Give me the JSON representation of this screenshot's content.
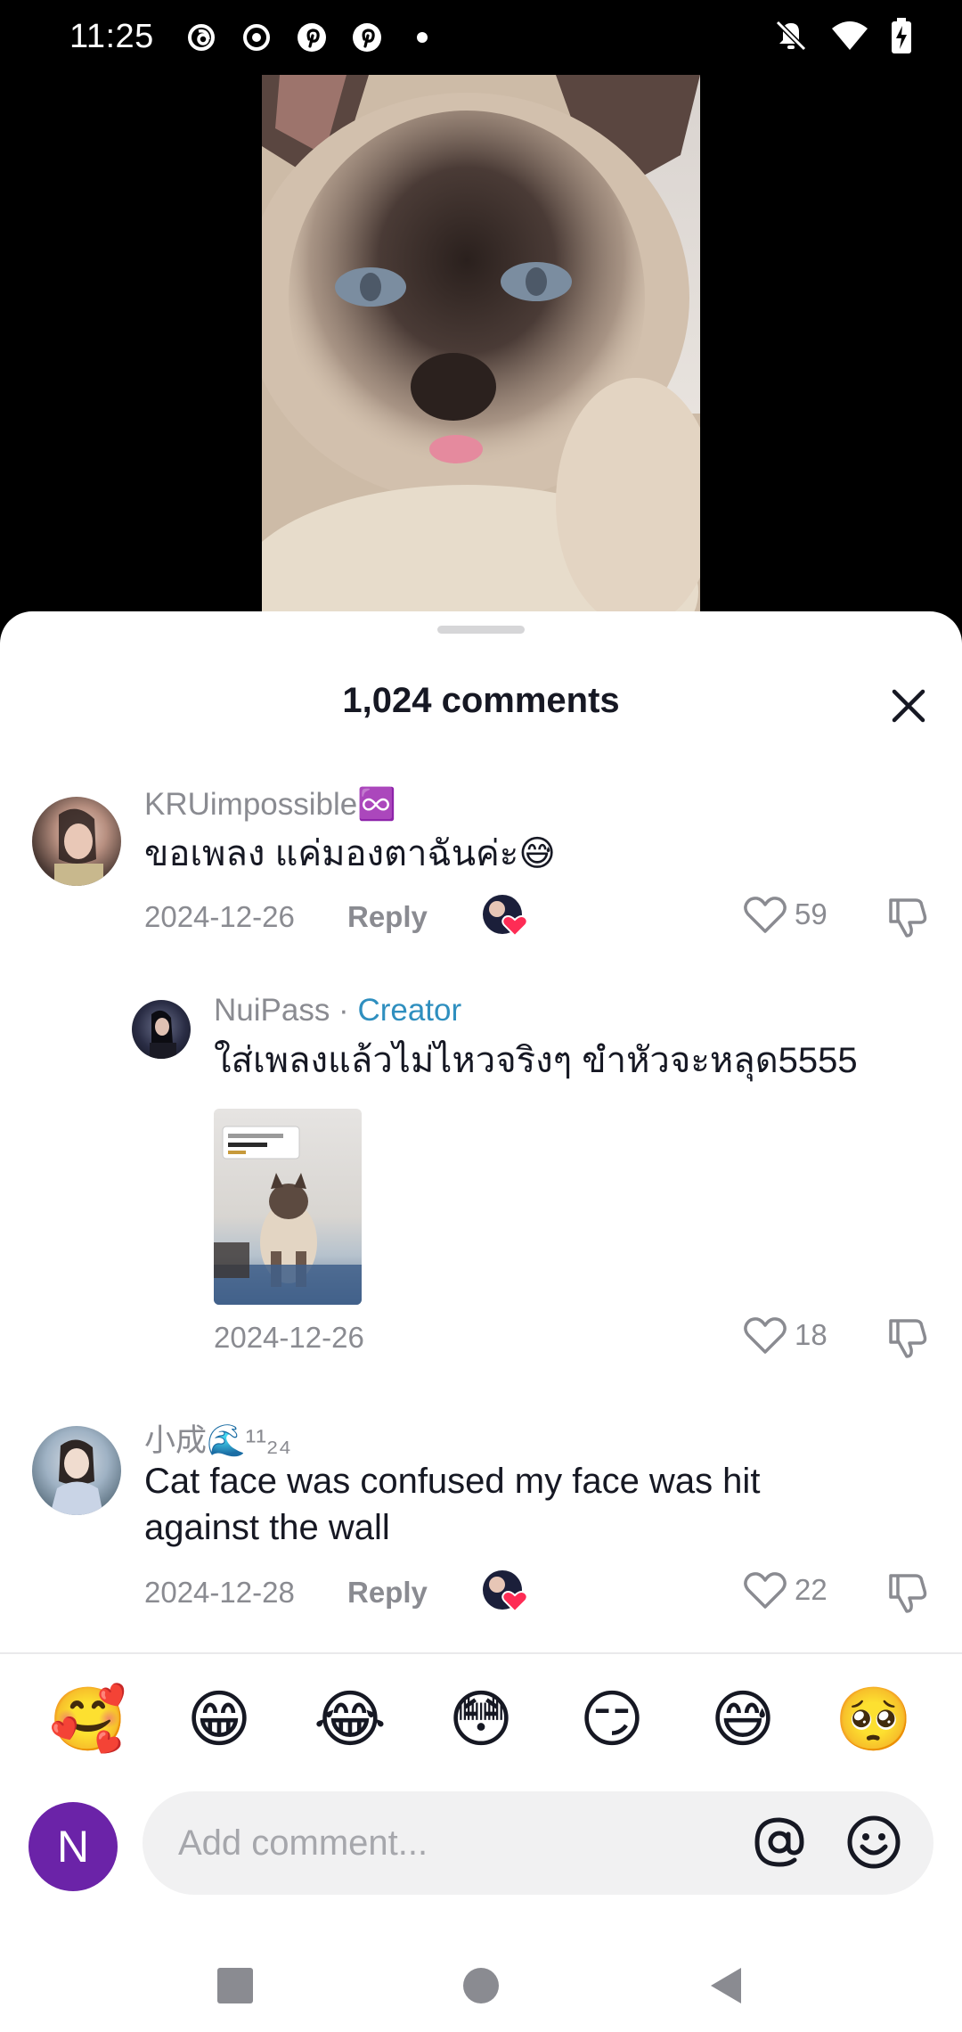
{
  "status_bar": {
    "time": "11:25",
    "left_icons": [
      "threads-icon",
      "record-icon",
      "pinterest-icon",
      "pinterest-icon",
      "dot-icon"
    ],
    "right_icons": [
      "mute-icon",
      "wifi-icon",
      "battery-charging-icon"
    ]
  },
  "sheet": {
    "title": "1,024 comments"
  },
  "comments": [
    {
      "username": "KRUimpossible♾️",
      "text": "ขอเพลง แค่มองตาฉันค่ะ😅",
      "date": "2024-12-26",
      "reply_label": "Reply",
      "likes": "59"
    },
    {
      "username": "NuiPass",
      "separator": " · ",
      "creator_label": "Creator",
      "text": "ใส่เพลงแล้วไม่ไหวจริงๆ ขำหัวจะหลุด5555",
      "date": "2024-12-26",
      "likes": "18"
    },
    {
      "username": "小成🌊¹¹₂₄",
      "text": "Cat face was confused my face was hit against the wall",
      "date": "2024-12-28",
      "reply_label": "Reply",
      "likes": "22"
    }
  ],
  "emoji_bar": [
    "🥰",
    "😁",
    "😂",
    "😳",
    "😏",
    "😅",
    "🥺"
  ],
  "composer": {
    "avatar_letter": "N",
    "placeholder": "Add comment...",
    "avatar_color": "#6b23a8"
  },
  "colors": {
    "creator": "#2f8fbf",
    "muted_text": "#8a8b91",
    "heart": "#fe2c55"
  }
}
